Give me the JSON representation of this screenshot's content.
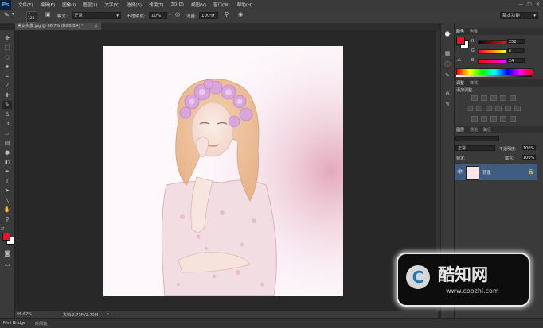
{
  "app": {
    "logo": "Ps"
  },
  "menubar": {
    "items": [
      "文件(F)",
      "编辑(E)",
      "图像(I)",
      "图层(L)",
      "文字(Y)",
      "选择(S)",
      "滤镜(T)",
      "3D(D)",
      "视图(V)",
      "窗口(W)",
      "帮助(H)"
    ],
    "window_controls": [
      "—",
      "□",
      "✕"
    ]
  },
  "options_bar": {
    "brush_size": "125",
    "mode_label": "模式:",
    "mode_value": "正常",
    "opacity_label": "不透明度:",
    "opacity_value": "10%",
    "flow_label": "流量:",
    "flow_value": "100%",
    "workspace": "基本功能"
  },
  "document": {
    "tab_title": "美女头像.jpg @ 66.7% (RGB/8#) *",
    "zoom": "66.67%",
    "doc_info": "文档:2.75M/2.75M"
  },
  "color_panel": {
    "tabs": [
      "颜色",
      "色板"
    ],
    "r_label": "R",
    "r_value": "252",
    "g_label": "G",
    "g_value": "6",
    "b_label": "B",
    "b_value": "24",
    "foreground_color": "#e8112a",
    "background_color": "#ffffff"
  },
  "adjustments_panel": {
    "tabs": [
      "调整",
      "样式"
    ],
    "title": "添加调整"
  },
  "layers_panel": {
    "tabs": [
      "图层",
      "通道",
      "路径"
    ],
    "blend_mode": "正常",
    "opacity_label": "不透明度:",
    "opacity_value": "100%",
    "lock_label": "锁定:",
    "fill_label": "填充:",
    "fill_value": "100%",
    "layers": [
      {
        "name": "背景"
      }
    ]
  },
  "bottom_tabs": [
    "Mini Bridge",
    "时间轴"
  ],
  "watermark": {
    "brand": "酷知网",
    "url": "www.coozhi.com",
    "logo_letter": "C"
  },
  "colors": {
    "accent": "#e8112a",
    "panel": "#3a3a3a",
    "canvas_bg": "#282828",
    "selected_layer": "#3f5c83"
  }
}
